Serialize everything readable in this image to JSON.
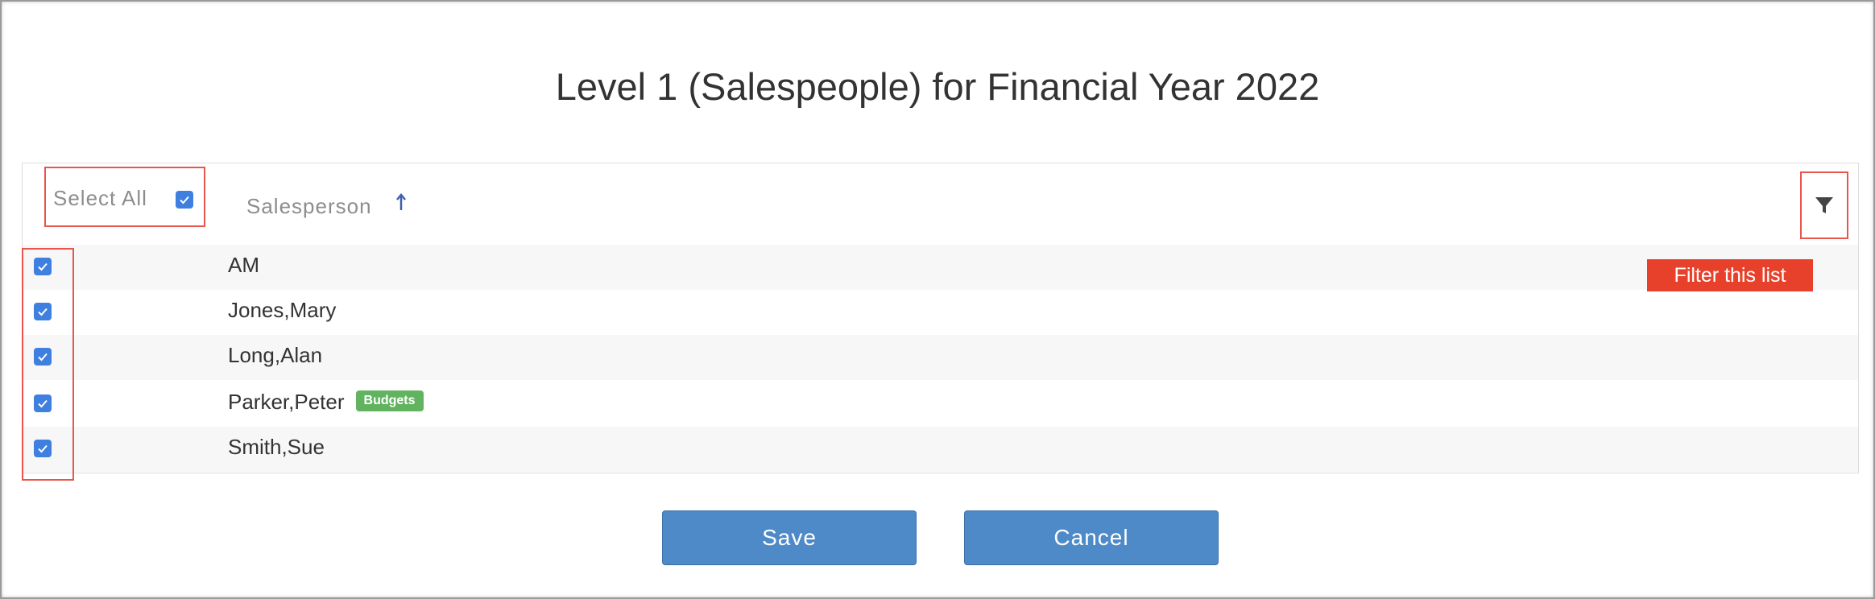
{
  "dialog": {
    "title": "Level 1 (Salespeople) for Financial Year 2022"
  },
  "list": {
    "select_all_label": "Select All",
    "select_all_checked": true,
    "column_header": "Salesperson",
    "sort_direction": "ascending",
    "filter_tooltip": "Filter this list",
    "rows": [
      {
        "name": "AM",
        "checked": true,
        "badge": ""
      },
      {
        "name": "Jones,Mary",
        "checked": true,
        "badge": ""
      },
      {
        "name": "Long,Alan",
        "checked": true,
        "badge": ""
      },
      {
        "name": "Parker,Peter",
        "checked": true,
        "badge": "Budgets"
      },
      {
        "name": "Smith,Sue",
        "checked": true,
        "badge": ""
      }
    ]
  },
  "buttons": {
    "save_label": "Save",
    "cancel_label": "Cancel"
  },
  "colors": {
    "checkbox": "#3f7fe0",
    "highlight": "#e8554a",
    "tooltip": "#e8412b",
    "badge": "#62b35f",
    "button": "#4f8ac8"
  },
  "icons": [
    "checkbox-checked-icon",
    "sort-ascending-icon",
    "filter-icon"
  ]
}
